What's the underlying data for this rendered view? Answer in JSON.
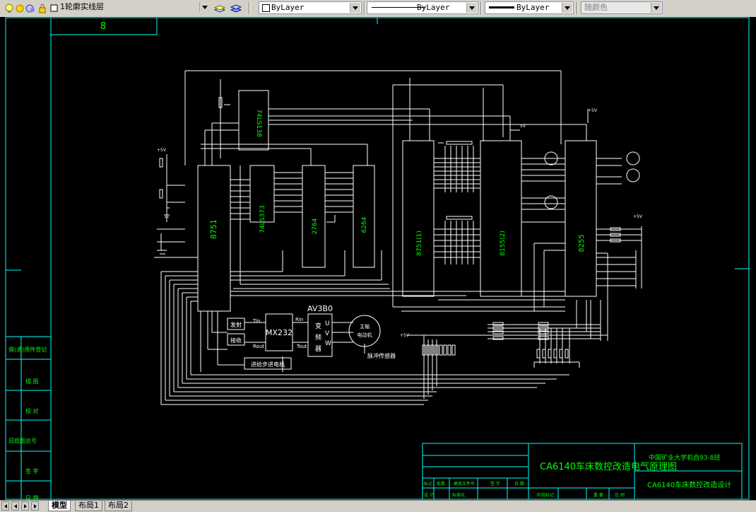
{
  "toolbar": {
    "layer_name": "1轮廓实线层",
    "color_control": "ByLayer",
    "linetype_control": "ByLayer",
    "lineweight_control": "ByLayer",
    "plotstyle_control": "随颜色"
  },
  "tabs": [
    {
      "label": "模型",
      "active": true
    },
    {
      "label": "布局1",
      "active": false
    },
    {
      "label": "布局2",
      "active": false
    }
  ],
  "drawing": {
    "top_box_label": "8",
    "left_column_labels": [
      "借(通)用件登记",
      "描 图",
      "校 对",
      "旧底图总号",
      "签 字",
      "日 期"
    ],
    "chips": {
      "c8751": "8751",
      "c74ls138": "74LS138",
      "c74ls373": "74LS373",
      "c2764": "2764",
      "c6264": "6264",
      "c8751_1": "8751(1)",
      "c8155": "8155(2)",
      "c8255": "8255",
      "mx232": "MX232",
      "av3b0": "AV3B0"
    },
    "converter": {
      "left": [
        "变",
        "频",
        "器"
      ],
      "right": [
        "U",
        "V",
        "W"
      ]
    },
    "motor": [
      "主轴",
      "电动机"
    ],
    "encoder_label": "脉冲传感器",
    "tx_box": "发射",
    "rx_box": "接收",
    "pins": {
      "tin": "Tin",
      "rout": "Rout",
      "rin": "Rin",
      "tout": "Tout",
      "vcc5": "+5V",
      "v5": "5V"
    },
    "feed_box": "进给步进电机",
    "title_block": {
      "project_title": "CA6140车床数控改造电气原理图",
      "school": "中国矿业大学机自93-8班",
      "design_title": "CA6140车床数控改造设计",
      "row1": [
        "标记",
        "处数",
        "更改文件号",
        "签 字",
        "日 期"
      ],
      "row2": [
        "设 计",
        "标准化",
        "阶段标记",
        "重 量",
        "比 例"
      ]
    }
  },
  "colors": {
    "canvas": "#000000",
    "border": "#00ffff",
    "wire": "#ffffff",
    "label": "#ffffff",
    "accent": "#00ff00"
  }
}
